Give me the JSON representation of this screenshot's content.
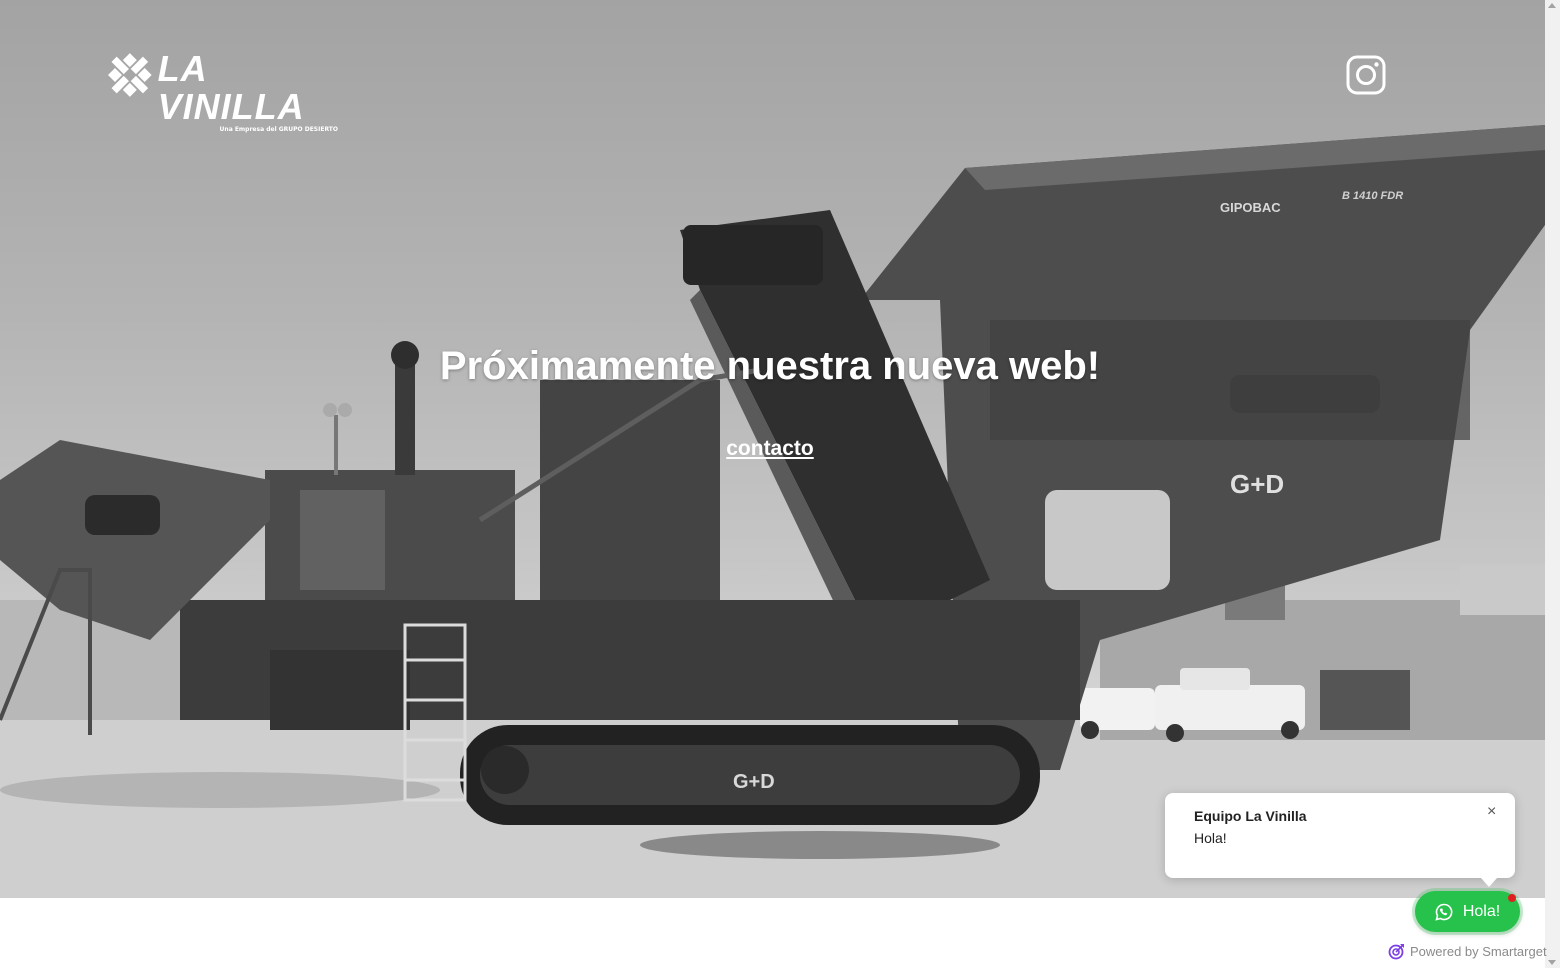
{
  "brand": {
    "name": "LA VINILLA",
    "tagline": "Una Empresa del GRUPO DESIERTO",
    "logo_icon": "x-diamond-logo-icon"
  },
  "social": {
    "instagram_icon": "instagram-icon"
  },
  "hero": {
    "headline": "Próximamente nuestra nueva web!",
    "contact_link": "contacto",
    "photo_labels": [
      "GIPOBAC",
      "B 1410 FDR"
    ]
  },
  "chat": {
    "sender": "Equipo La Vinilla",
    "message": "Hola!",
    "close_glyph": "×",
    "button_label": "Hola!",
    "button_icon": "whatsapp-icon",
    "button_color": "#27c24c",
    "notification_color": "#e02020"
  },
  "footer": {
    "powered_by": "Powered by Smartarget"
  }
}
